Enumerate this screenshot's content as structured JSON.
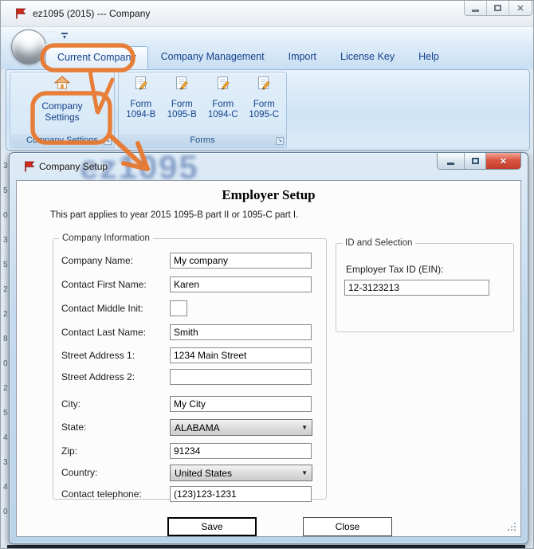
{
  "window": {
    "title": "ez1095 (2015) --- Company"
  },
  "ribbon": {
    "tabs": [
      {
        "label": "Current Company",
        "active": true
      },
      {
        "label": "Company Management",
        "active": false
      },
      {
        "label": "Import",
        "active": false
      },
      {
        "label": "License Key",
        "active": false
      },
      {
        "label": "Help",
        "active": false
      }
    ],
    "groups": [
      {
        "caption": "Company Settings",
        "button_label": "Company Settings"
      },
      {
        "caption": "Forms",
        "buttons": [
          {
            "label": "Form 1094-B"
          },
          {
            "label": "Form 1095-B"
          },
          {
            "label": "Form 1094-C"
          },
          {
            "label": "Form 1095-C"
          }
        ]
      }
    ]
  },
  "background_watermark": "ez1095",
  "left_edge_fragments": "3\n5\n0\n3\n5\n2\n2\n8\n0\n2\n5\n4\n3\n4\n0",
  "dialog": {
    "title": "Company Setup",
    "heading": "Employer Setup",
    "description": "This part applies to year 2015 1095-B part II or 1095-C part I.",
    "company_information": {
      "caption": "Company Information",
      "fields": [
        {
          "label": "Company Name:",
          "value": "My company"
        },
        {
          "label": "Contact First Name:",
          "value": "Karen"
        },
        {
          "label": "Contact Middle Init:",
          "value": ""
        },
        {
          "label": "Contact Last Name:",
          "value": "Smith"
        },
        {
          "label": "Street Address 1:",
          "value": "1234 Main Street"
        },
        {
          "label": "Street Address 2:",
          "value": ""
        },
        {
          "label": "City:",
          "value": "My City"
        },
        {
          "label": "State:",
          "value": "ALABAMA"
        },
        {
          "label": "Zip:",
          "value": "91234"
        },
        {
          "label": "Country:",
          "value": "United States"
        },
        {
          "label": "Contact telephone:",
          "value": "(123)123-1231"
        }
      ]
    },
    "id_and_selection": {
      "caption": "ID and Selection",
      "ein_label": "Employer Tax ID (EIN):",
      "ein_value": "12-3123213"
    },
    "buttons": {
      "save": "Save",
      "close": "Close"
    }
  },
  "icons": {
    "dropdown_arrow": "▼",
    "close_glyph": "✕",
    "qat_arrow": "▾",
    "launcher_arrow": "↘"
  },
  "colors": {
    "annotation_orange": "#E8772C",
    "tab_text_blue": "#15428B",
    "close_button_red": "#C23B28"
  }
}
